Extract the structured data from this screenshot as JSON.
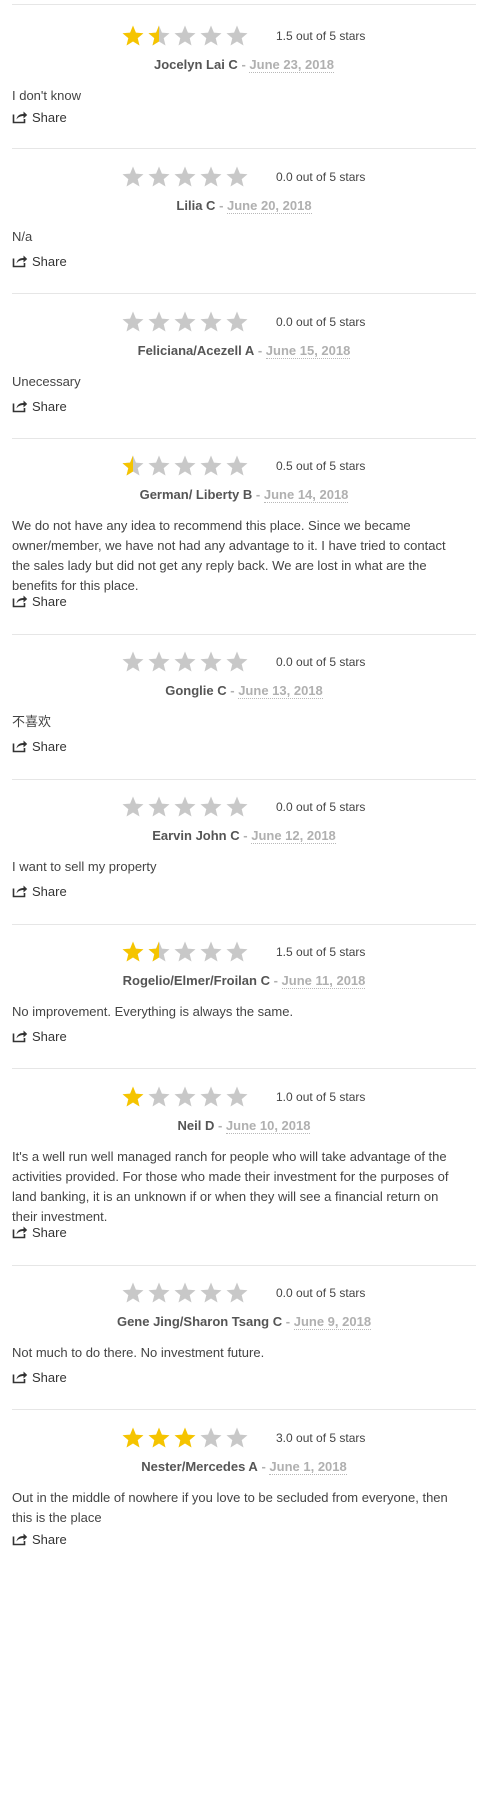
{
  "colors": {
    "star_filled": "#f5c400",
    "star_empty": "#c8c8c8"
  },
  "share_label": "Share",
  "reviews": [
    {
      "rating": 1.5,
      "rating_text": "1.5 out of 5 stars",
      "author": "Jocelyn Lai C",
      "date": "June 23, 2018",
      "body": "I don't know"
    },
    {
      "rating": 0.0,
      "rating_text": "0.0 out of 5 stars",
      "author": "Lilia C",
      "date": "June 20, 2018",
      "body": "N/a"
    },
    {
      "rating": 0.0,
      "rating_text": "0.0 out of 5 stars",
      "author": "Feliciana/Acezell A",
      "date": "June 15, 2018",
      "body": "Unecessary"
    },
    {
      "rating": 0.5,
      "rating_text": "0.5 out of 5 stars",
      "author": "German/ Liberty B",
      "date": "June 14, 2018",
      "body": "We do not have any idea to recommend this place. Since we became owner/member, we have not had any advantage to it. I have tried to contact the sales lady but did not get any reply back. We are lost in what are the benefits for this place."
    },
    {
      "rating": 0.0,
      "rating_text": "0.0 out of 5 stars",
      "author": "Gonglie C",
      "date": "June 13, 2018",
      "body": "不喜欢"
    },
    {
      "rating": 0.0,
      "rating_text": "0.0 out of 5 stars",
      "author": "Earvin John C",
      "date": "June 12, 2018",
      "body": "I want to sell my property"
    },
    {
      "rating": 1.5,
      "rating_text": "1.5 out of 5 stars",
      "author": "Rogelio/Elmer/Froilan C",
      "date": "June 11, 2018",
      "body": "No improvement. Everything is always the same."
    },
    {
      "rating": 1.0,
      "rating_text": "1.0 out of 5 stars",
      "author": "Neil D",
      "date": "June 10, 2018",
      "body": "It's a well run well managed ranch for people who will take advantage of the activities provided. For those who made their investment for the purposes of land banking, it is an unknown if or when they will see a financial return on their investment."
    },
    {
      "rating": 0.0,
      "rating_text": "0.0 out of 5 stars",
      "author": "Gene Jing/Sharon Tsang C",
      "date": "June 9, 2018",
      "body": "Not much to do there. No investment future."
    },
    {
      "rating": 3.0,
      "rating_text": "3.0 out of 5 stars",
      "author": "Nester/Mercedes A",
      "date": "June 1, 2018",
      "body": "Out in the middle of nowhere if you love to be secluded from everyone, then this is the place"
    }
  ]
}
